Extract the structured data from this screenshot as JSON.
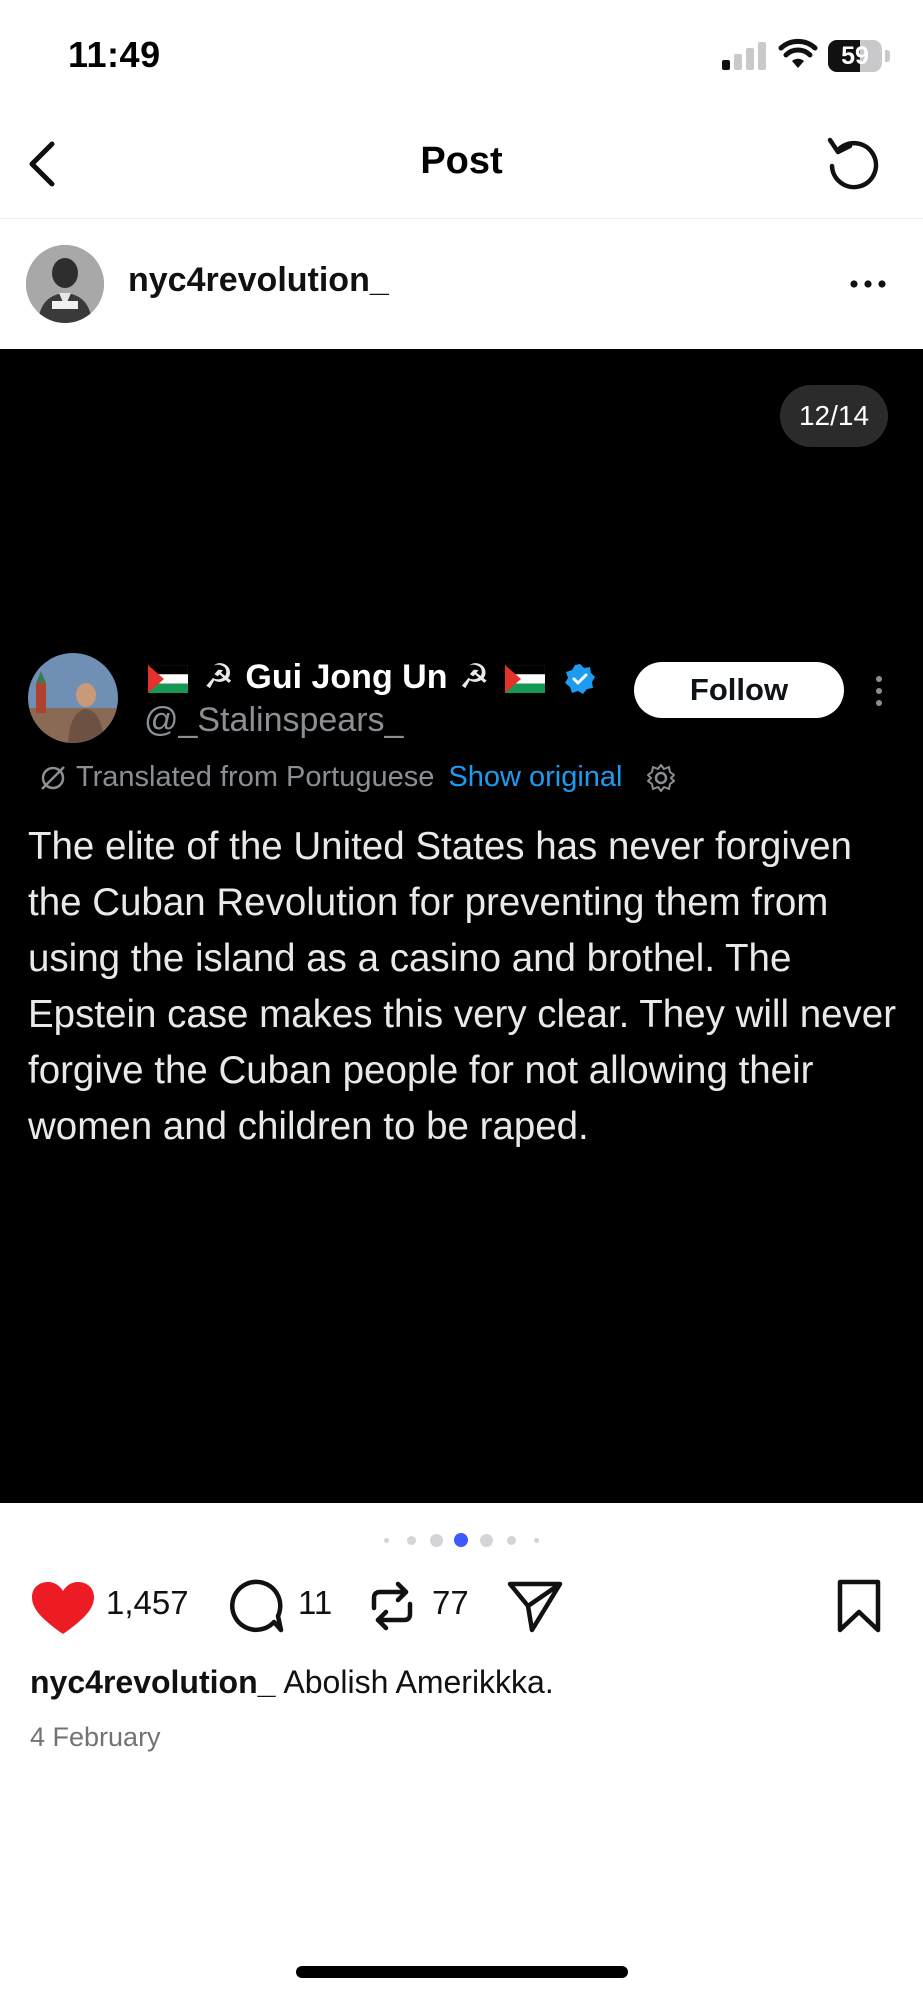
{
  "status_bar": {
    "time": "11:49",
    "battery": "59",
    "battery_level": 0.59
  },
  "nav": {
    "title": "Post"
  },
  "post": {
    "username": "nyc4revolution_",
    "media_counter": "12/14",
    "carousel": {
      "total_dots": 7,
      "active_dot": 4
    }
  },
  "tweet": {
    "display_name": "Gui Jong Un",
    "handle": "@_Stalinspears_",
    "follow_label": "Follow",
    "translated_label": "Translated from Portuguese",
    "show_original_label": "Show original",
    "text": "The elite of the United States has never forgiven the Cuban Revolution for preventing them from using the island as a casino and brothel. The Epstein case makes this very clear. They will never forgive the Cuban people for not allowing their women and children to be raped."
  },
  "actions": {
    "likes": "1,457",
    "comments": "11",
    "reposts": "77"
  },
  "caption": {
    "username": "nyc4revolution_",
    "text": "Abolish Amerikkka."
  },
  "date": "4 February",
  "colors": {
    "like": "#ed1c24",
    "verified": "#1d9bf0",
    "active_dot": "#3d5afe",
    "link": "#1d9bf0"
  }
}
